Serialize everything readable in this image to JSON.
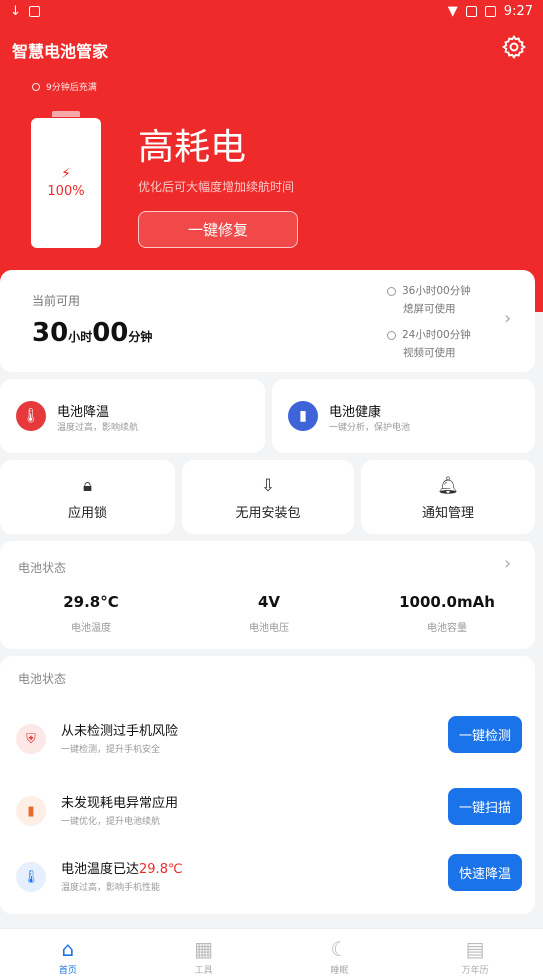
{
  "status_bar": {
    "time": "9:27"
  },
  "header": {
    "app_title": "智慧电池管家",
    "settings_icon": "gear-icon"
  },
  "hero": {
    "charge_hint": "9分钟后充满",
    "battery_percent": "100%",
    "status_title": "高耗电",
    "status_subtitle": "优化后可大幅度增加续航时间",
    "fix_button": "一键修复",
    "accent_color": "#ef2a2a"
  },
  "available": {
    "label": "当前可用",
    "hours": "30",
    "hours_unit": "小时",
    "minutes": "00",
    "minutes_unit": "分钟",
    "standby_time": "36小时00分钟",
    "standby_label": "熄屏可使用",
    "video_time": "24小时00分钟",
    "video_label": "视频可使用"
  },
  "features": [
    {
      "title": "电池降温",
      "subtitle": "温度过高，影响续航",
      "icon": "thermometer-icon"
    },
    {
      "title": "电池健康",
      "subtitle": "一键分析，保护电池",
      "icon": "battery-health-icon"
    }
  ],
  "tools": [
    {
      "label": "应用锁",
      "icon": "lock-icon"
    },
    {
      "label": "无用安装包",
      "icon": "package-icon"
    },
    {
      "label": "通知管理",
      "icon": "bell-icon"
    }
  ],
  "battery_state": {
    "title": "电池状态",
    "stats": [
      {
        "value": "29.8°C",
        "label": "电池温度"
      },
      {
        "value": "4V",
        "label": "电池电压"
      },
      {
        "value": "1000.0mAh",
        "label": "电池容量"
      }
    ]
  },
  "checks": {
    "title": "电池状态",
    "items": [
      {
        "title": "从未检测过手机风险",
        "subtitle": "一键检测，提升手机安全",
        "button": "一键检测",
        "icon": "shield-icon"
      },
      {
        "title": "未发现耗电异常应用",
        "subtitle": "一键优化，提升电池续航",
        "button": "一键扫描",
        "icon": "battery-icon"
      },
      {
        "title_prefix": "电池温度已达",
        "title_value": "29.8℃",
        "subtitle": "温度过高，影响手机性能",
        "button": "快速降温",
        "icon": "thermometer-icon"
      }
    ]
  },
  "nav": [
    {
      "label": "首页",
      "icon": "home-icon"
    },
    {
      "label": "工具",
      "icon": "tools-icon"
    },
    {
      "label": "睡眠",
      "icon": "moon-icon"
    },
    {
      "label": "万年历",
      "icon": "calendar-icon"
    }
  ]
}
